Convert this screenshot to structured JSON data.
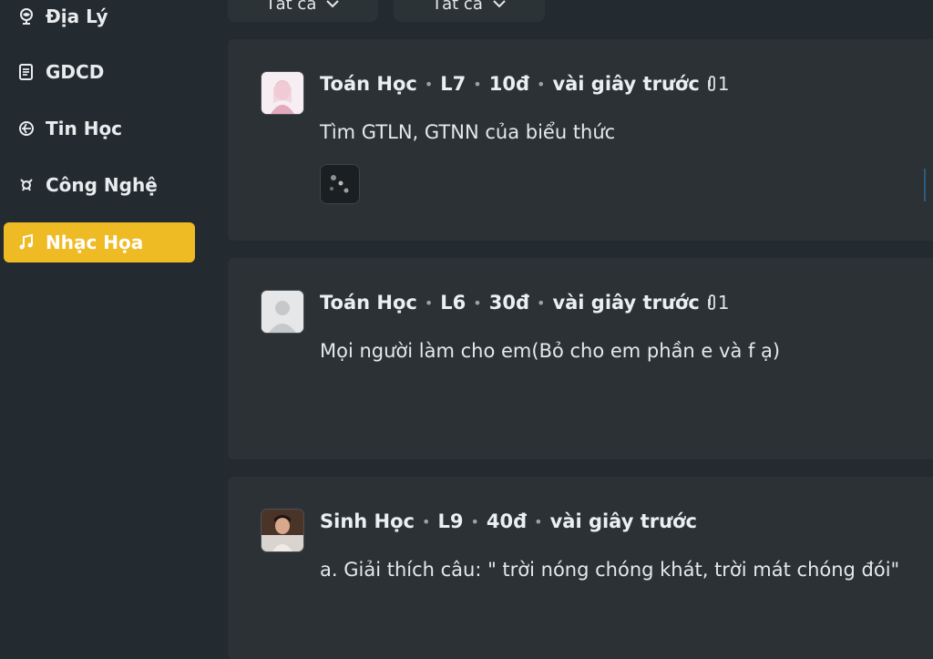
{
  "filters": [
    {
      "label": "Tất cả"
    },
    {
      "label": "Tất cả"
    }
  ],
  "sidebar": {
    "items": [
      {
        "label": "Địa Lý",
        "icon": "globe-icon",
        "active": false
      },
      {
        "label": "GDCD",
        "icon": "document-icon",
        "active": false
      },
      {
        "label": "Tin Học",
        "icon": "computer-icon",
        "active": false
      },
      {
        "label": "Công Nghệ",
        "icon": "gear-icon",
        "active": false
      },
      {
        "label": "Nhạc Họa",
        "icon": "music-icon",
        "active": true
      }
    ]
  },
  "questions": [
    {
      "subject": "Toán Học",
      "grade": "L7",
      "points": "10đ",
      "time": "vài giây trước",
      "attachments": "1",
      "content": "Tìm GTLN, GTNN của biểu thức",
      "has_thumbnail": true
    },
    {
      "subject": "Toán Học",
      "grade": "L6",
      "points": "30đ",
      "time": "vài giây trước",
      "attachments": "1",
      "content": "Mọi người làm cho em(Bỏ cho em phần e và f ạ)",
      "has_thumbnail": false
    },
    {
      "subject": "Sinh Học",
      "grade": "L9",
      "points": "40đ",
      "time": "vài giây trước",
      "attachments": "",
      "content": "a. Giải thích câu: \" trời nóng chóng khát, trời mát chóng đói\"",
      "has_thumbnail": false
    }
  ],
  "colors": {
    "background": "#232b30",
    "card": "#2b3134",
    "accent": "#efbb24"
  }
}
